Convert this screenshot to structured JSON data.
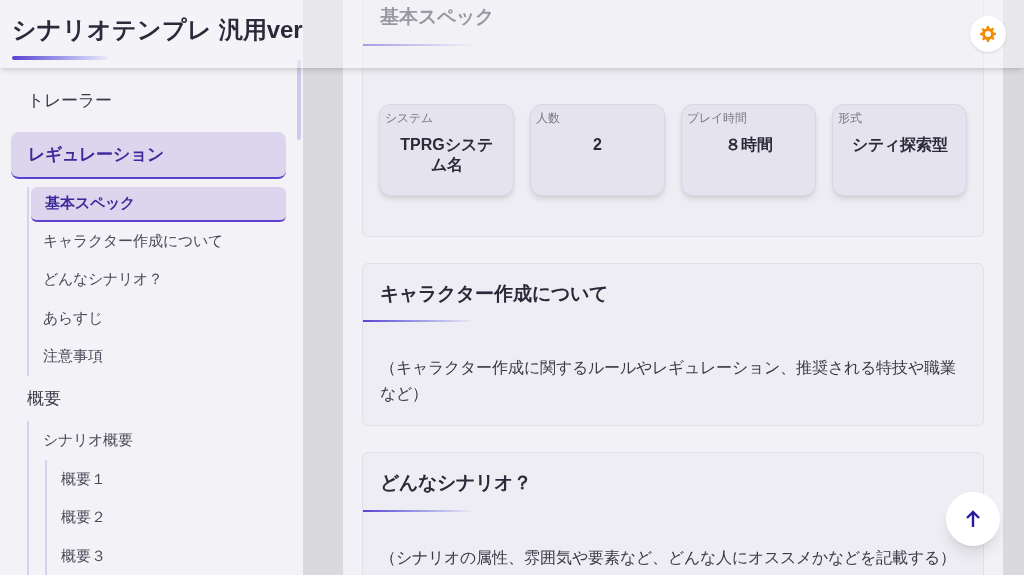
{
  "header": {
    "title": "シナリオテンプレ 汎用ver"
  },
  "sidebar": {
    "items": [
      {
        "label": "トレーラー",
        "selected": false
      },
      {
        "label": "レギュレーション",
        "selected": true,
        "children": [
          {
            "label": "基本スペック",
            "selected": true
          },
          {
            "label": "キャラクター作成について",
            "selected": false
          },
          {
            "label": "どんなシナリオ？",
            "selected": false
          },
          {
            "label": "あらすじ",
            "selected": false
          },
          {
            "label": "注意事項",
            "selected": false
          }
        ]
      },
      {
        "label": "概要",
        "selected": false,
        "children": [
          {
            "label": "シナリオ概要",
            "selected": false,
            "children": [
              {
                "label": "概要１",
                "selected": false
              },
              {
                "label": "概要２",
                "selected": false
              },
              {
                "label": "概要３",
                "selected": false
              }
            ]
          }
        ]
      }
    ]
  },
  "sections": [
    {
      "heading": "基本スペック",
      "specs": [
        {
          "label": "システム",
          "value": "TPRGシステム名"
        },
        {
          "label": "人数",
          "value": "2"
        },
        {
          "label": "プレイ時間",
          "value": "８時間"
        },
        {
          "label": "形式",
          "value": "シティ探索型"
        }
      ]
    },
    {
      "heading": "キャラクター作成について",
      "text": "（キャラクター作成に関するルールやレギュレーション、推奨される特技や職業など）"
    },
    {
      "heading": "どんなシナリオ？",
      "text": "（シナリオの属性、雰囲気や要素など、どんな人にオススメかなどを記載する）"
    }
  ]
}
